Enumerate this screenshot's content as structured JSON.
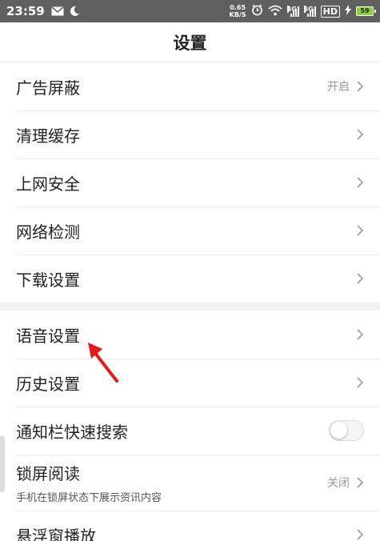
{
  "status_bar": {
    "time": "23:59",
    "speed_value": "0.65",
    "speed_unit": "KB/S",
    "net1": "4G",
    "net2": "3G",
    "hd": "HD",
    "battery": "59",
    "icons": [
      "mail-icon",
      "moon-icon",
      "alarm-icon",
      "wifi-icon",
      "signal-icon",
      "charging-icon"
    ]
  },
  "header": {
    "title": "设置"
  },
  "groups": [
    {
      "items": [
        {
          "label": "广告屏蔽",
          "value": "开启"
        },
        {
          "label": "清理缓存"
        },
        {
          "label": "上网安全"
        },
        {
          "label": "网络检测"
        },
        {
          "label": "下载设置"
        }
      ]
    },
    {
      "items": [
        {
          "label": "语音设置"
        },
        {
          "label": "历史设置"
        },
        {
          "label": "通知栏快速搜索",
          "toggle": false
        },
        {
          "label": "锁屏阅读",
          "subtitle": "手机在锁屏状态下展示资讯内容",
          "value": "关闭"
        },
        {
          "label": "悬浮窗播放"
        }
      ]
    }
  ],
  "colors": {
    "annotation_arrow": "#e31b1b",
    "statusbar_bg": "#5f5f5f",
    "battery_fill": "#8cd13b"
  }
}
